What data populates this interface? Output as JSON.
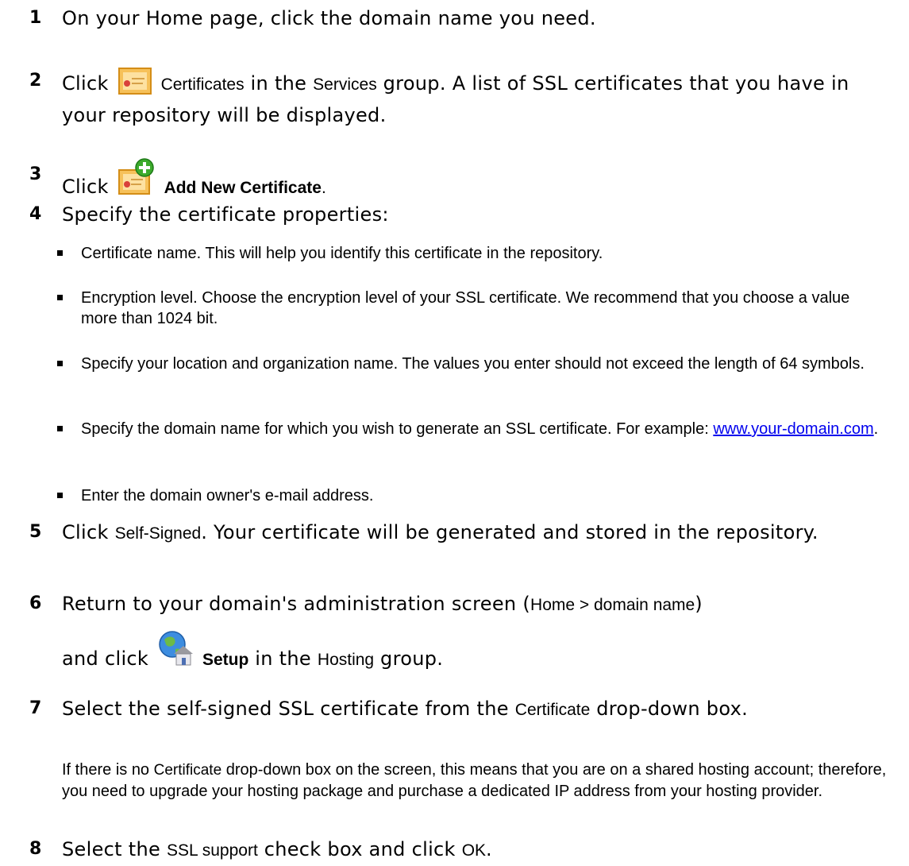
{
  "steps": [
    {
      "num": "1",
      "text": "On your Home page, click the domain name you need."
    },
    {
      "num": "2",
      "pre": "Click",
      "ui": "Certificates",
      "mid": "in the",
      "ui2": "Services",
      "post": "group. A list of SSL certificates that you have in your repository will be displayed.",
      "icon": "certificate-icon"
    },
    {
      "num": "3",
      "pre": "Click",
      "ui": "Add New Certificate",
      "post": ".",
      "icon": "add-certificate-icon"
    },
    {
      "num": "4",
      "text": "Specify the certificate properties:"
    },
    {
      "num": "5",
      "pre": "Click",
      "ui": "Self-Signed",
      "post": ". Your certificate will be generated and stored in the repository."
    },
    {
      "num": "6",
      "pre": "Return to your domain's administration screen (",
      "ui": "Home > domain name",
      "post": ")",
      "line2_pre": "and click",
      "line2_ui": "Setup",
      "line2_mid": "in the",
      "line2_ui2": "Hosting",
      "line2_post": "group.",
      "icon": "hosting-setup-icon"
    },
    {
      "num": "7",
      "pre": "Select the self-signed SSL certificate from the",
      "ui": "Certificate",
      "post": "drop-down box."
    },
    {
      "num": "8",
      "pre": "Select the",
      "ui": "SSL support",
      "mid": "check box and click",
      "ui2": "OK",
      "post": "."
    }
  ],
  "bullets": [
    "Certificate name. This will help you identify this certificate in the repository.",
    "Encryption level. Choose the encryption level of your SSL certificate. We recommend that you choose a value more than 1024 bit.",
    "Specify your location and organization name. The values you enter should not exceed the length of 64 symbols.",
    {
      "pre": "Specify the domain name for which you wish to generate an SSL certificate. For example: ",
      "link": "www.your-domain.com",
      "post": "."
    },
    "Enter the domain owner's e-mail address."
  ],
  "note": {
    "pre": "If there is no",
    "ui": "Certificate",
    "post": "drop-down box on the screen, this means that you are on a shared hosting account; therefore, you need to upgrade your hosting package and purchase a dedicated IP address from your hosting provider."
  }
}
